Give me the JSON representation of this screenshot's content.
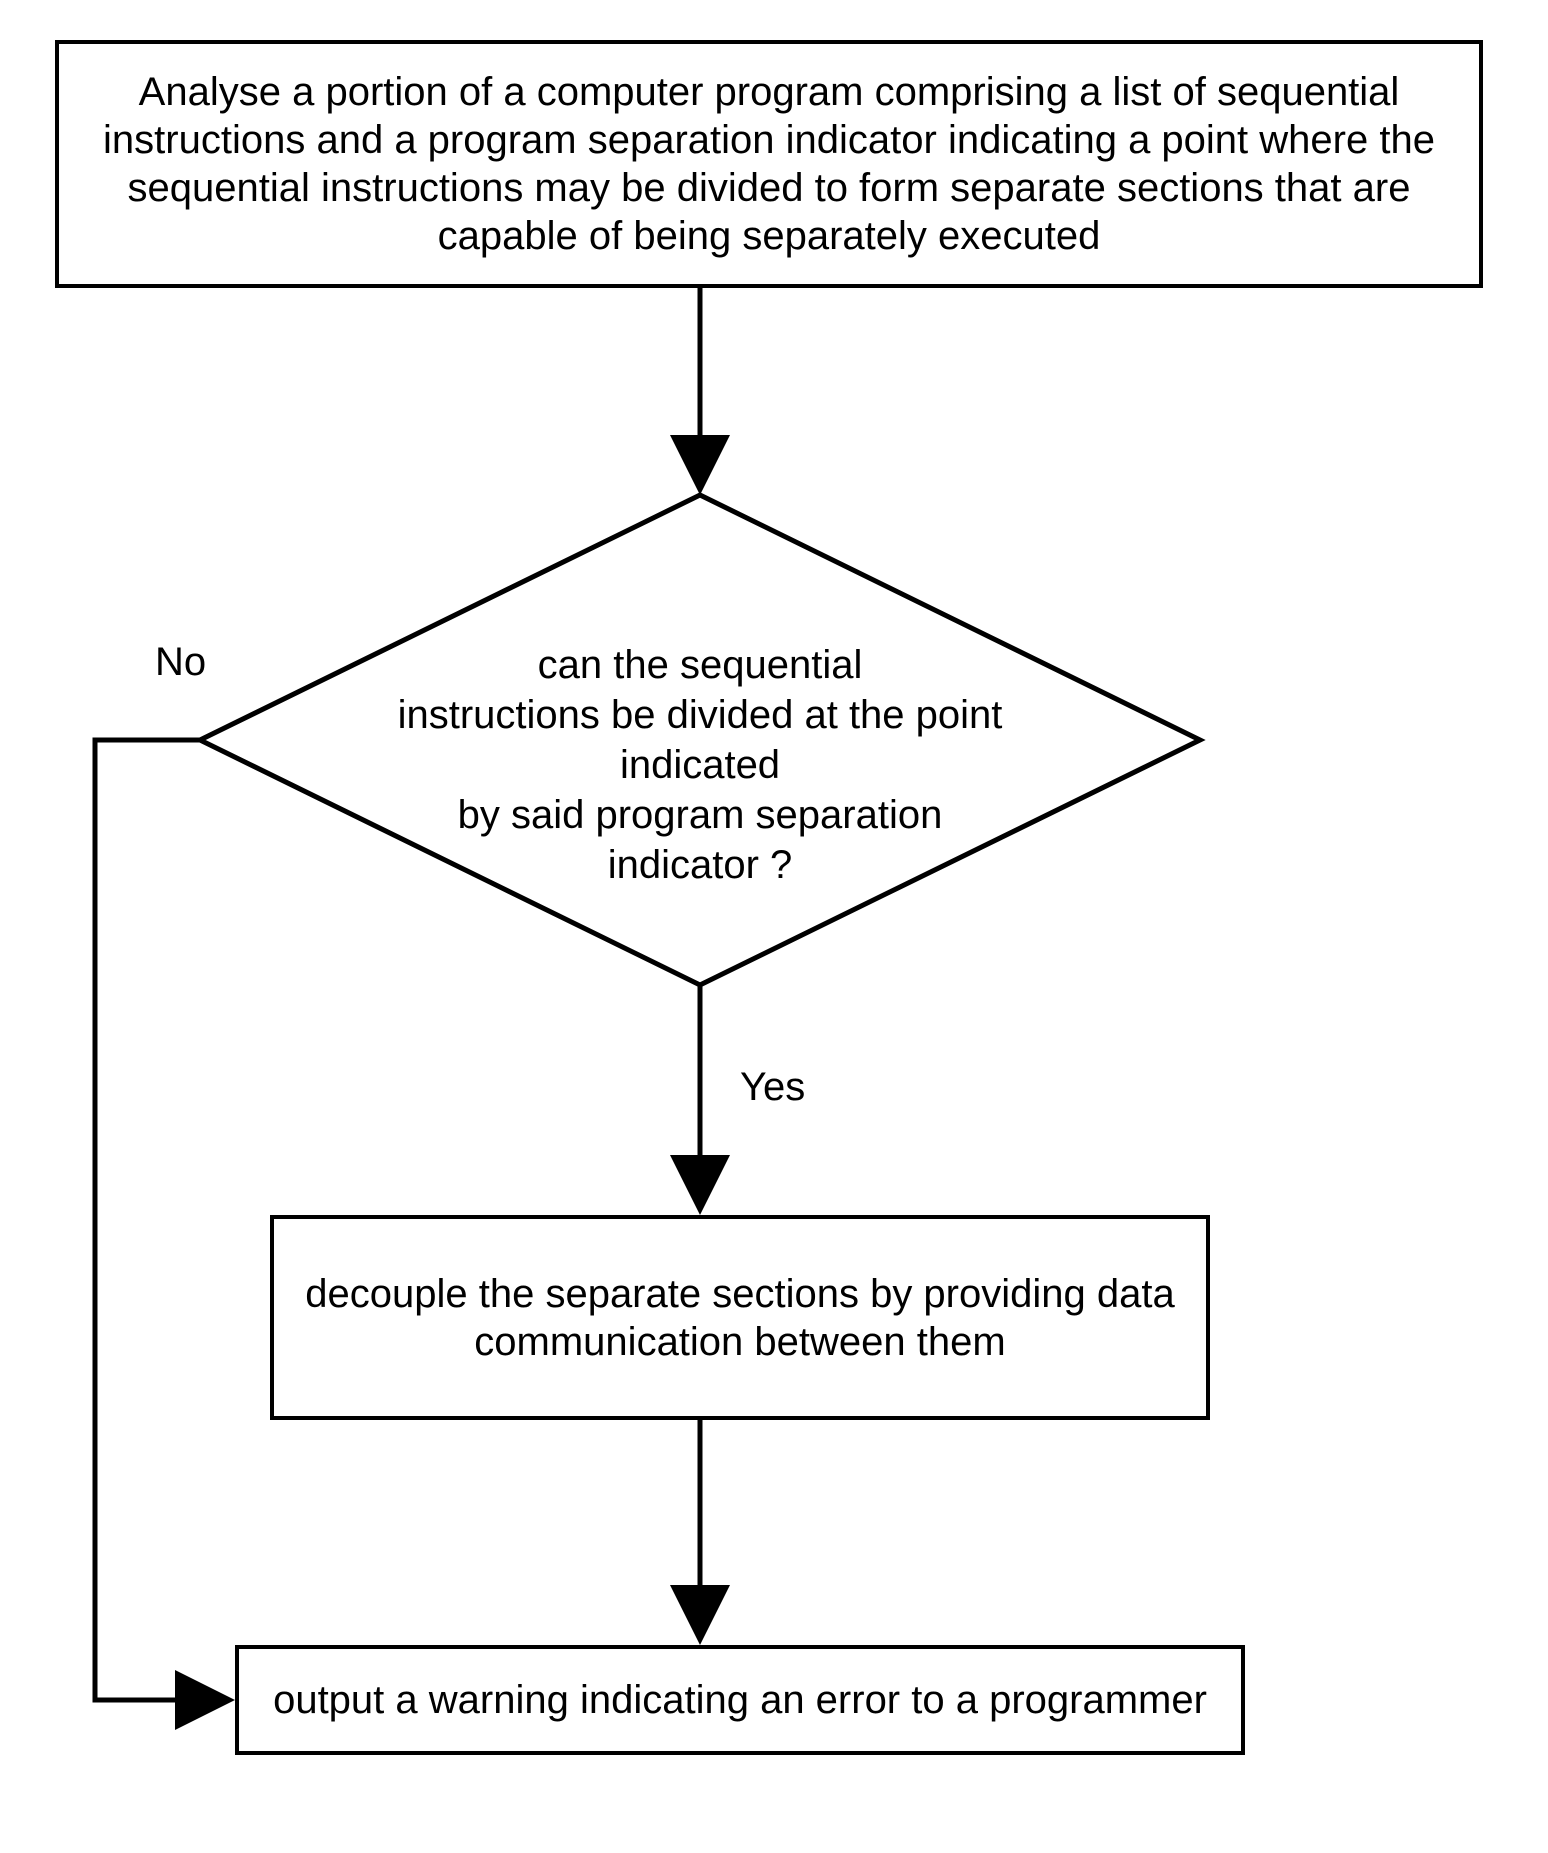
{
  "flowchart": {
    "step1": "Analyse a portion of a computer program comprising a list of sequential instructions and a program separation indicator indicating a point where the sequential instructions may be divided to form separate sections that are capable of being separately executed",
    "decision": "can the sequential\ninstructions be divided at the point indicated\nby said program separation\nindicator ?",
    "yes_label": "Yes",
    "no_label": "No",
    "step2": "decouple the separate sections by providing data communication between them",
    "step3": "output a warning indicating an error to a programmer"
  }
}
